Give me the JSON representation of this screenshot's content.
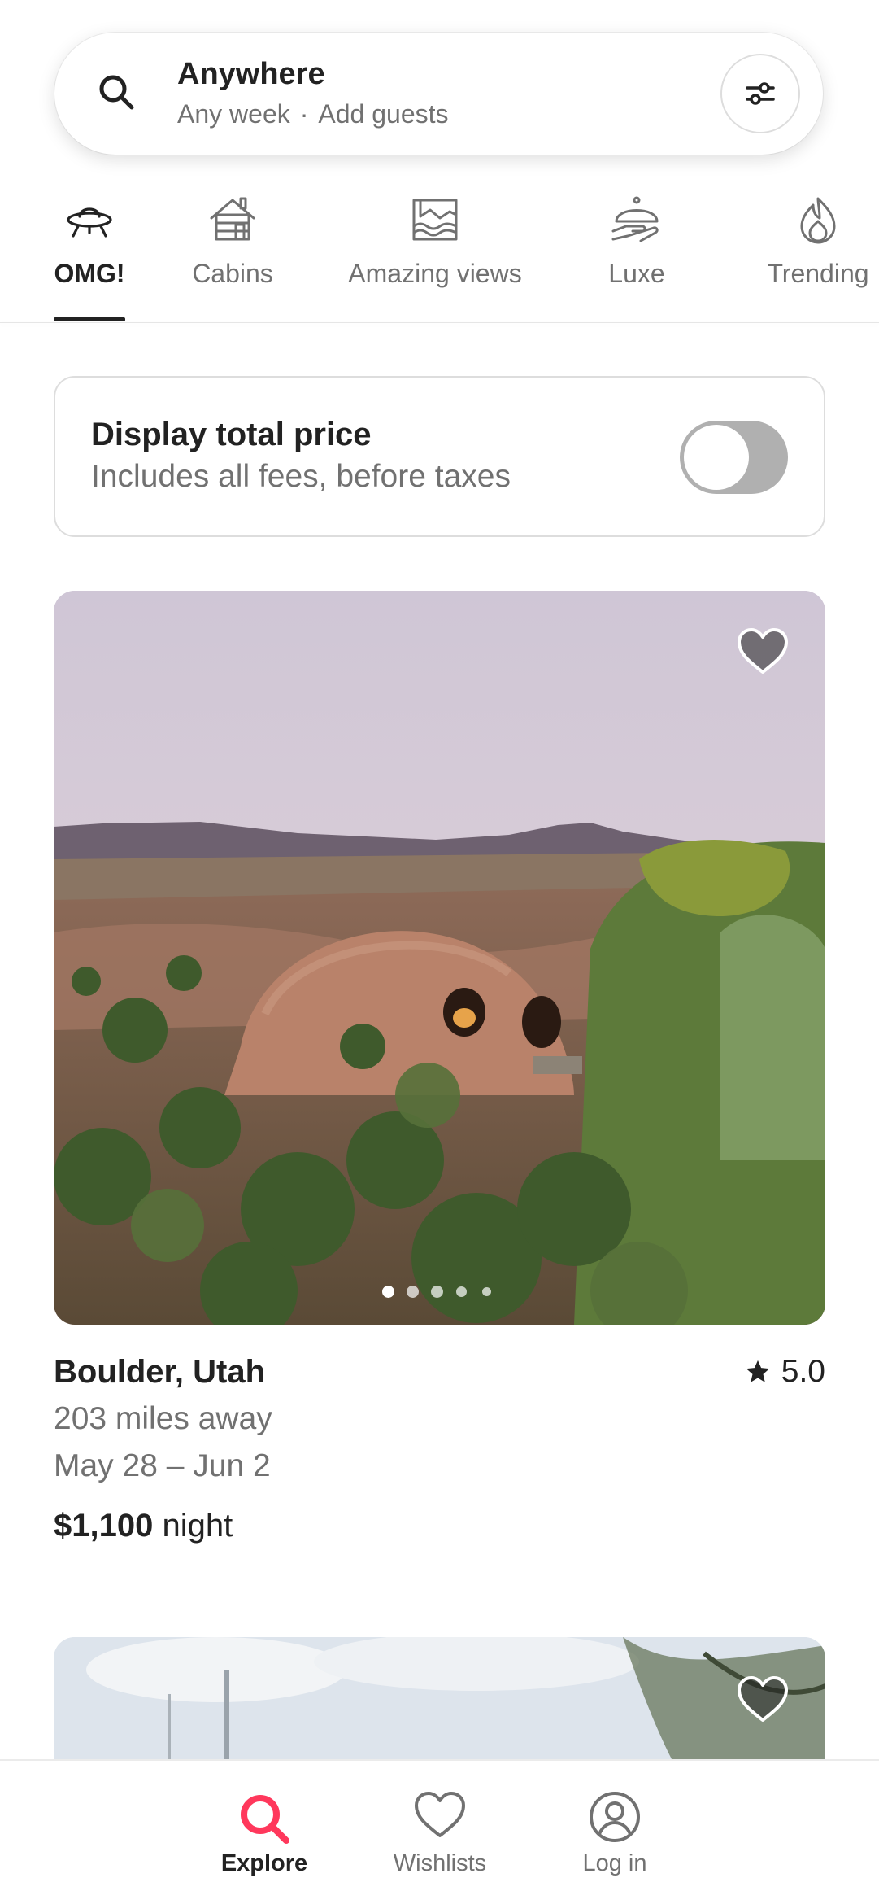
{
  "search": {
    "title": "Anywhere",
    "week": "Any week",
    "separator": "·",
    "guests": "Add guests"
  },
  "categories": [
    {
      "label": "OMG!",
      "icon": "ufo-icon",
      "active": true
    },
    {
      "label": "Cabins",
      "icon": "cabin-icon",
      "active": false
    },
    {
      "label": "Amazing views",
      "icon": "amazing-views-icon",
      "active": false
    },
    {
      "label": "Luxe",
      "icon": "luxe-icon",
      "active": false
    },
    {
      "label": "Trending",
      "icon": "flame-icon",
      "active": false
    }
  ],
  "price_toggle": {
    "title": "Display total price",
    "subtitle": "Includes all fees, before taxes",
    "enabled": false
  },
  "listing": {
    "location": "Boulder, Utah",
    "rating": "5.0",
    "distance": "203 miles away",
    "dates": "May 28 – Jun 2",
    "price": "$1,100",
    "price_unit": "night",
    "photo_count_dots": 5,
    "active_photo": 1
  },
  "bottom_nav": [
    {
      "label": "Explore",
      "icon": "search-icon",
      "active": true
    },
    {
      "label": "Wishlists",
      "icon": "heart-icon",
      "active": false
    },
    {
      "label": "Log in",
      "icon": "user-icon",
      "active": false
    }
  ],
  "colors": {
    "brand": "#ff385c",
    "text_primary": "#222222",
    "text_secondary": "#717171",
    "border": "#dddddd"
  }
}
